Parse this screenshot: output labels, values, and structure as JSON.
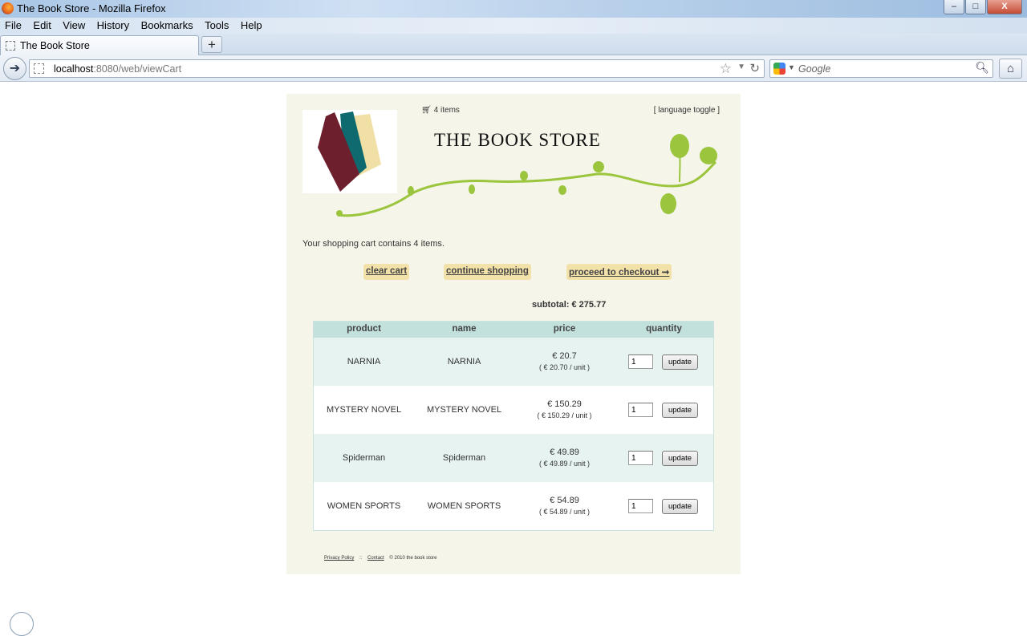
{
  "window": {
    "title": "The Book Store - Mozilla Firefox",
    "controls": [
      "–",
      "□",
      "X"
    ]
  },
  "menu": [
    "File",
    "Edit",
    "View",
    "History",
    "Bookmarks",
    "Tools",
    "Help"
  ],
  "tab": {
    "label": "The Book Store",
    "new_tab": "+"
  },
  "address": {
    "host": "localhost",
    "path": ":8080/web/viewCart"
  },
  "search": {
    "placeholder": "Google"
  },
  "header": {
    "cart_items": "4 items",
    "language_toggle": "[ language toggle ]",
    "store_title": "THE BOOK STORE"
  },
  "cart": {
    "message": "Your shopping cart contains 4 items.",
    "actions": {
      "clear": "clear cart",
      "continue": "continue shopping",
      "checkout": "proceed to checkout ➞"
    },
    "subtotal": "subtotal: € 275.77",
    "columns": [
      "product",
      "name",
      "price",
      "quantity"
    ],
    "update_label": "update",
    "rows": [
      {
        "product": "NARNIA",
        "name": "NARNIA",
        "price": "€ 20.7",
        "unit": "( € 20.70 / unit )",
        "quantity": "1"
      },
      {
        "product": "MYSTERY NOVEL",
        "name": "MYSTERY NOVEL",
        "price": "€ 150.29",
        "unit": "( € 150.29 / unit )",
        "quantity": "1"
      },
      {
        "product": "Spiderman",
        "name": "Spiderman",
        "price": "€ 49.89",
        "unit": "( € 49.89 / unit )",
        "quantity": "1"
      },
      {
        "product": "WOMEN SPORTS",
        "name": "WOMEN SPORTS",
        "price": "€ 54.89",
        "unit": "( € 54.89 / unit )",
        "quantity": "1"
      }
    ]
  },
  "footer": {
    "privacy": "Privacy Policy",
    "separator": "::",
    "contact": "Contact",
    "copyright": "© 2010 the book store"
  },
  "colors": {
    "page_bg": "#f5f5ea",
    "table_header": "#c2e0dc",
    "row_alt": "#e6f3f1",
    "action_button": "#f2e1a9",
    "vine_green": "#9bc53d",
    "book_maroon": "#6e1f2e",
    "book_teal": "#0e6a6e",
    "book_cream": "#f1e0a6"
  }
}
